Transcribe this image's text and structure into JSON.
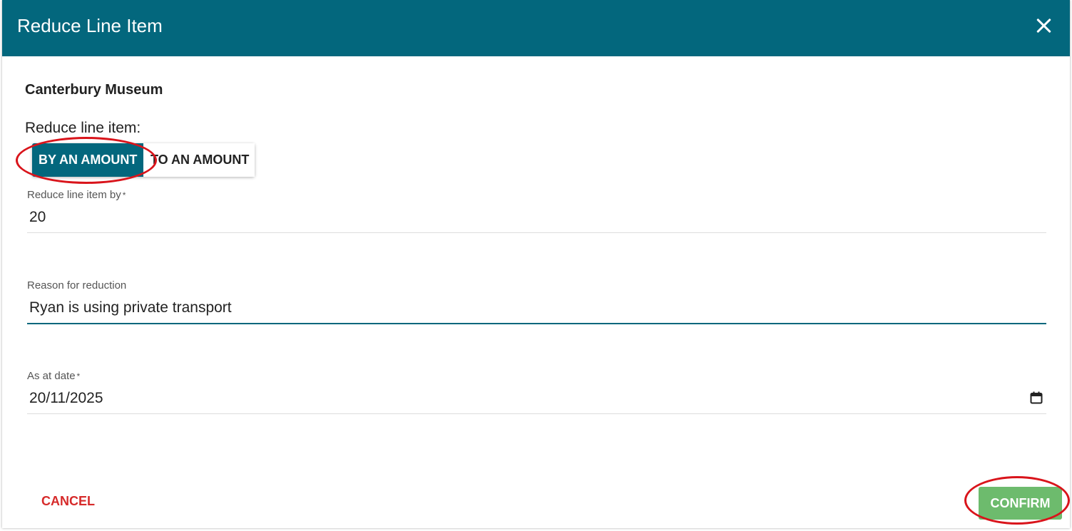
{
  "dialog": {
    "title": "Reduce Line Item",
    "close_icon": "close-icon"
  },
  "org_name": "Canterbury Museum",
  "reduce_label": "Reduce line item:",
  "toggle": {
    "options": [
      {
        "label": "BY AN AMOUNT",
        "selected": true
      },
      {
        "label": "TO AN AMOUNT",
        "selected": false
      }
    ]
  },
  "fields": {
    "reduce_by": {
      "label": "Reduce line item by",
      "required_mark": "*",
      "value": "20"
    },
    "reason": {
      "label": "Reason for reduction",
      "value": "Ryan is using private transport"
    },
    "as_at_date": {
      "label": "As at date",
      "required_mark": "*",
      "value": "20/11/2025",
      "icon": "calendar-icon"
    }
  },
  "actions": {
    "cancel_label": "CANCEL",
    "confirm_label": "CONFIRM"
  },
  "colors": {
    "header": "#03677d",
    "toggle_active": "#03677d",
    "cancel": "#d62a2a",
    "confirm": "#6dbb6d",
    "annotation": "#d9141b"
  }
}
